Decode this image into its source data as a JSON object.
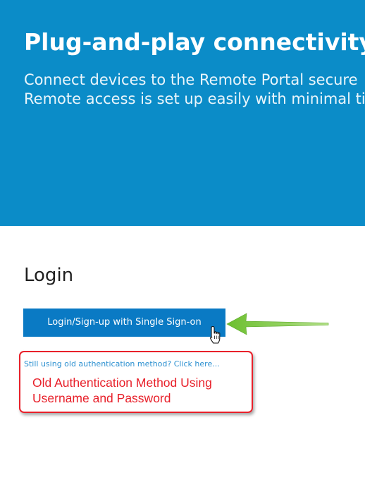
{
  "hero": {
    "title": "Plug-and-play connectivity",
    "description_line1": "Connect devices to the Remote Portal secure",
    "description_line2": "Remote access is set up easily with minimal ti",
    "background_color": "#0b8cc8"
  },
  "login": {
    "heading": "Login",
    "sso_button_label": "Login/Sign-up with Single Sign-on",
    "button_color": "#0a7ac4",
    "old_auth_link": "Still using old authentication method? Click here..."
  },
  "annotation": {
    "line1": "Old Authentication Method Using",
    "line2": "Username and Password",
    "callout_color": "#e8202a",
    "arrow_color": "#7cc243",
    "arrow_icon": "green-arrow-icon",
    "cursor_icon": "hand-pointer-icon"
  }
}
